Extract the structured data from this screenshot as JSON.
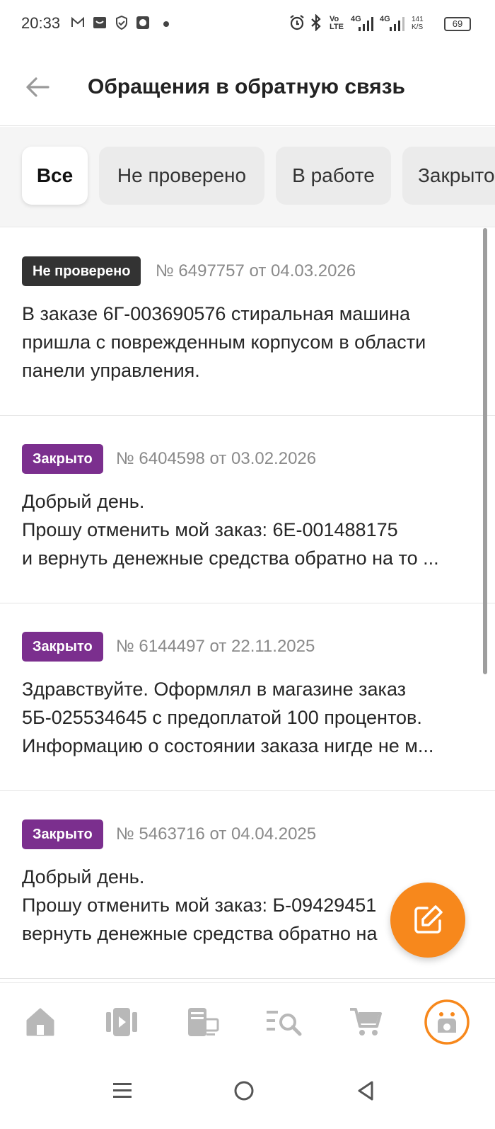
{
  "status_bar": {
    "time": "20:33",
    "network_1": "Vo LTE",
    "network_2": "4G",
    "network_3": "4G",
    "speed": "141 K/S",
    "battery": "69",
    "icons": [
      "gmail-icon",
      "inbox-icon",
      "shield-icon",
      "chat-icon",
      "dot-icon",
      "alarm-icon",
      "bluetooth-icon",
      "signal-icon",
      "signal-icon"
    ]
  },
  "header": {
    "title": "Обращения в обратную связь",
    "back_icon": "arrow-left-icon"
  },
  "filters": [
    {
      "label": "Все",
      "active": true
    },
    {
      "label": "Не проверено",
      "active": false
    },
    {
      "label": "В работе",
      "active": false
    },
    {
      "label": "Закрыто",
      "active": false
    }
  ],
  "tickets": [
    {
      "status": "Не проверено",
      "status_color": "#333333",
      "meta": "№ 6497757 от 04.03.2026",
      "lines": [
        "В заказе 6Г-003690576 стиральная машина",
        "пришла с поврежденным корпусом в области",
        "панели управления."
      ]
    },
    {
      "status": "Закрыто",
      "status_color": "#7b2f8e",
      "meta": "№ 6404598 от 03.02.2026",
      "lines": [
        "Добрый день.",
        "Прошу отменить мой заказ: 6Е-001488175",
        "и вернуть денежные средства обратно на то ..."
      ]
    },
    {
      "status": "Закрыто",
      "status_color": "#7b2f8e",
      "meta": "№ 6144497 от 22.11.2025",
      "lines": [
        "Здравствуйте. Оформлял в магазине заказ",
        "5Б-025534645 с предоплатой 100 процентов.",
        "Информацию о состоянии заказа нигде не м..."
      ]
    },
    {
      "status": "Закрыто",
      "status_color": "#7b2f8e",
      "meta": "№ 5463716 от 04.04.2025",
      "lines": [
        "Добрый день.",
        "Прошу отменить мой заказ: Б-09429451",
        "вернуть денежные средства обратно на"
      ]
    }
  ],
  "fab": {
    "icon": "edit-icon",
    "color": "#f7881c"
  },
  "bottom_nav": [
    {
      "icon": "home-icon"
    },
    {
      "icon": "catalog-icon"
    },
    {
      "icon": "devices-icon"
    },
    {
      "icon": "search-list-icon"
    },
    {
      "icon": "cart-icon"
    },
    {
      "icon": "profile-icon",
      "active": true
    }
  ],
  "colors": {
    "accent": "#f7881c",
    "closed": "#7b2f8e",
    "unchecked": "#333333"
  }
}
